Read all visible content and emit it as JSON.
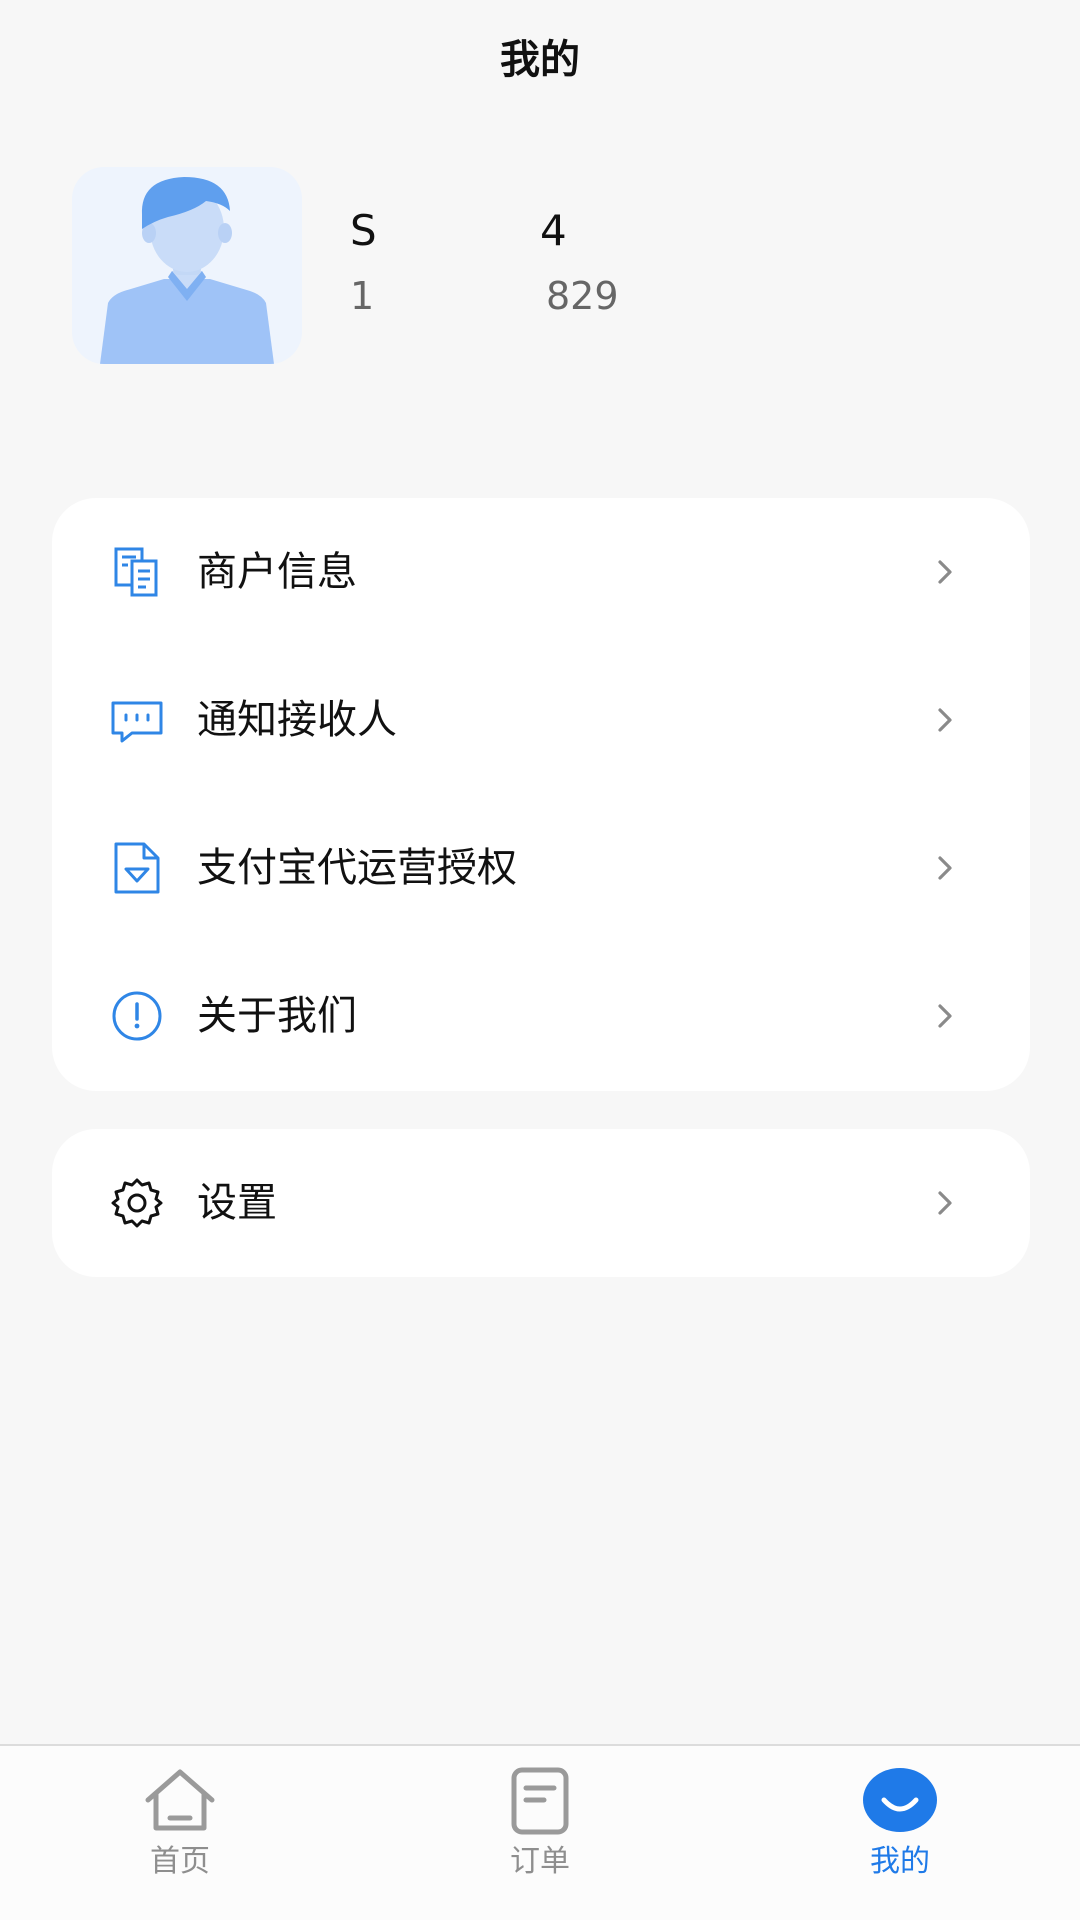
{
  "header": {
    "title": "我的"
  },
  "profile": {
    "name_start": "S",
    "name_end": "4",
    "phone_start": "1",
    "phone_end": "829"
  },
  "menu": {
    "items": [
      {
        "label": "商户信息",
        "icon": "merchant-document-icon"
      },
      {
        "label": "通知接收人",
        "icon": "chat-bubble-icon"
      },
      {
        "label": "支付宝代运营授权",
        "icon": "authorization-file-icon"
      },
      {
        "label": "关于我们",
        "icon": "info-circle-icon"
      }
    ],
    "settings": {
      "label": "设置",
      "icon": "gear-icon"
    }
  },
  "tabbar": {
    "tabs": [
      {
        "label": "首页",
        "icon": "home-icon",
        "active": false
      },
      {
        "label": "订单",
        "icon": "order-icon",
        "active": false
      },
      {
        "label": "我的",
        "icon": "smile-icon",
        "active": true
      }
    ]
  },
  "colors": {
    "accent": "#1f7ae8",
    "icon_blue": "#2f86e6",
    "background": "#f7f7f7",
    "card": "#ffffff",
    "inactive_tab": "#8e8e8e"
  }
}
